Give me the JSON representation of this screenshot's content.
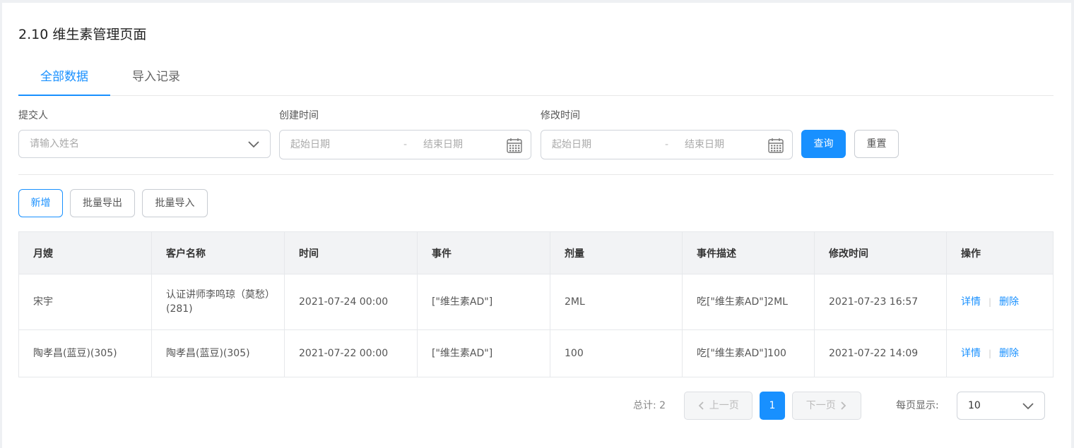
{
  "page": {
    "title": "2.10 维生素管理页面"
  },
  "tabs": [
    {
      "label": "全部数据",
      "active": true
    },
    {
      "label": "导入记录",
      "active": false
    }
  ],
  "filters": {
    "submitter": {
      "label": "提交人",
      "placeholder": "请输入姓名"
    },
    "created": {
      "label": "创建时间",
      "start_placeholder": "起始日期",
      "separator": "-",
      "end_placeholder": "结束日期"
    },
    "modified": {
      "label": "修改时间",
      "start_placeholder": "起始日期",
      "separator": "-",
      "end_placeholder": "结束日期"
    },
    "query_label": "查询",
    "reset_label": "重置"
  },
  "actions": {
    "add_label": "新增",
    "export_label": "批量导出",
    "import_label": "批量导入"
  },
  "table": {
    "columns": [
      "月嫂",
      "客户名称",
      "时间",
      "事件",
      "剂量",
      "事件描述",
      "修改时间",
      "操作"
    ],
    "rows": [
      {
        "nanny": "宋宇",
        "customer": "认证讲师李鸣琼（莫愁）(281)",
        "time": "2021-07-24 00:00",
        "event": "[\"维生素AD\"]",
        "dose": "2ML",
        "desc": "吃[\"维生素AD\"]2ML",
        "modified": "2021-07-23 16:57",
        "detail": "详情",
        "delete": "删除"
      },
      {
        "nanny": "陶孝昌(蓝豆)(305)",
        "customer": "陶孝昌(蓝豆)(305)",
        "time": "2021-07-22 00:00",
        "event": "[\"维生素AD\"]",
        "dose": "100",
        "desc": "吃[\"维生素AD\"]100",
        "modified": "2021-07-22 14:09",
        "detail": "详情",
        "delete": "删除"
      }
    ]
  },
  "pagination": {
    "total_text": "总计: 2",
    "prev_label": "上一页",
    "current_page": "1",
    "next_label": "下一页",
    "per_page_label": "每页显示:",
    "per_page_value": "10"
  },
  "colors": {
    "accent": "#1890ff",
    "header_bg": "#f2f3f5",
    "border": "#e6e8eb"
  }
}
